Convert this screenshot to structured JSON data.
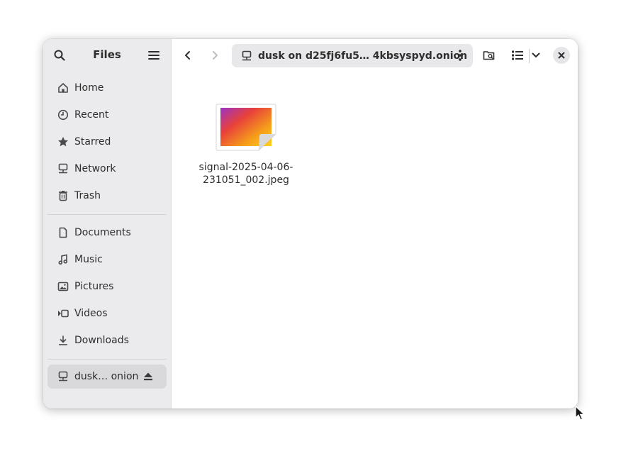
{
  "app": {
    "title": "Files"
  },
  "sidebar": {
    "search_icon": "search-icon",
    "menu_icon": "hamburger-menu-icon",
    "places": [
      {
        "label": "Home",
        "icon": "home-icon"
      },
      {
        "label": "Recent",
        "icon": "clock-icon"
      },
      {
        "label": "Starred",
        "icon": "star-icon"
      },
      {
        "label": "Network",
        "icon": "network-icon"
      },
      {
        "label": "Trash",
        "icon": "trash-icon"
      }
    ],
    "bookmarks": [
      {
        "label": "Documents",
        "icon": "document-icon"
      },
      {
        "label": "Music",
        "icon": "music-icon"
      },
      {
        "label": "Pictures",
        "icon": "picture-icon"
      },
      {
        "label": "Videos",
        "icon": "video-icon"
      },
      {
        "label": "Downloads",
        "icon": "download-icon"
      }
    ],
    "mounts": [
      {
        "label": "dusk… onion",
        "icon": "network-drive-icon",
        "active": true,
        "eject_icon": "eject-icon"
      }
    ]
  },
  "toolbar": {
    "back_icon": "chevron-left-icon",
    "forward_icon": "chevron-right-icon",
    "path": "dusk on d25fj6fu5…  4kbsyspyd.onion",
    "path_icon": "network-drive-icon",
    "path_menu_icon": "kebab-menu-icon",
    "search_folder_icon": "folder-search-icon",
    "view_icon": "list-view-icon",
    "view_dropdown_icon": "chevron-down-icon",
    "close_icon": "close-icon"
  },
  "files": [
    {
      "name_line1": "signal-2025-04-06-",
      "name_line2": "231051_002.jpeg",
      "icon": "image-thumbnail-icon"
    }
  ],
  "colors": {
    "sidebar_bg": "#ebebed",
    "active_row": "#d9d9dc",
    "pathbar_bg": "#e8e8ea",
    "thumb_gradient": [
      "#9b33c6",
      "#e8413a",
      "#f59b1a",
      "#ffd21f"
    ]
  }
}
